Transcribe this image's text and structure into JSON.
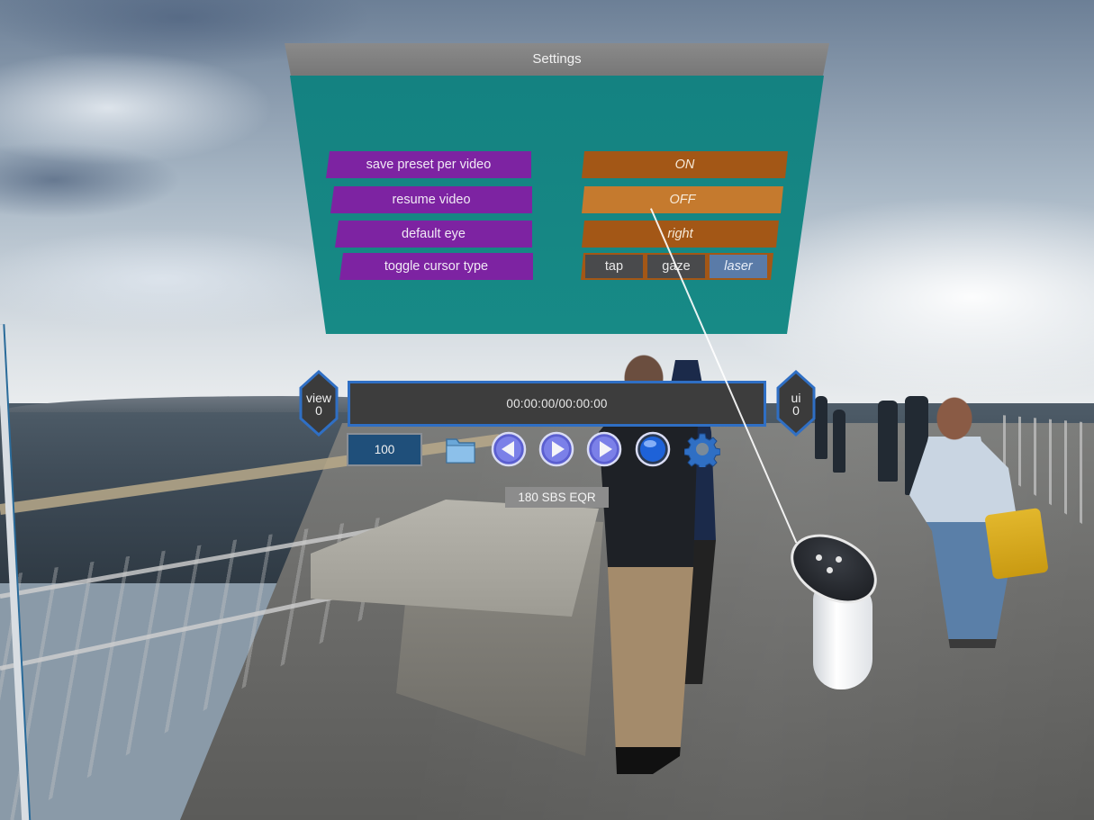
{
  "settings": {
    "title": "Settings",
    "rows": [
      {
        "label": "save preset per video",
        "value": "ON"
      },
      {
        "label": "resume video",
        "value": "OFF"
      },
      {
        "label": "default eye",
        "value": "right"
      },
      {
        "label": "toggle cursor type"
      }
    ],
    "cursor_type": {
      "options": [
        "tap",
        "gaze",
        "laser"
      ],
      "selected": "laser"
    }
  },
  "player": {
    "view": {
      "label": "view",
      "value": "0"
    },
    "ui": {
      "label": "ui",
      "value": "0"
    },
    "time": "00:00:00/00:00:00",
    "volume": "100",
    "format": "180 SBS EQR",
    "controls": [
      "folder-icon",
      "previous-icon",
      "play-icon",
      "next-icon",
      "record-icon",
      "gear-icon"
    ]
  },
  "colors": {
    "panel": "#178a86",
    "label": "#7d23a2",
    "value": "#a35716",
    "value_hover": "#c57a2e",
    "selected": "#5a7ba8",
    "accent": "#2f6fc4"
  }
}
